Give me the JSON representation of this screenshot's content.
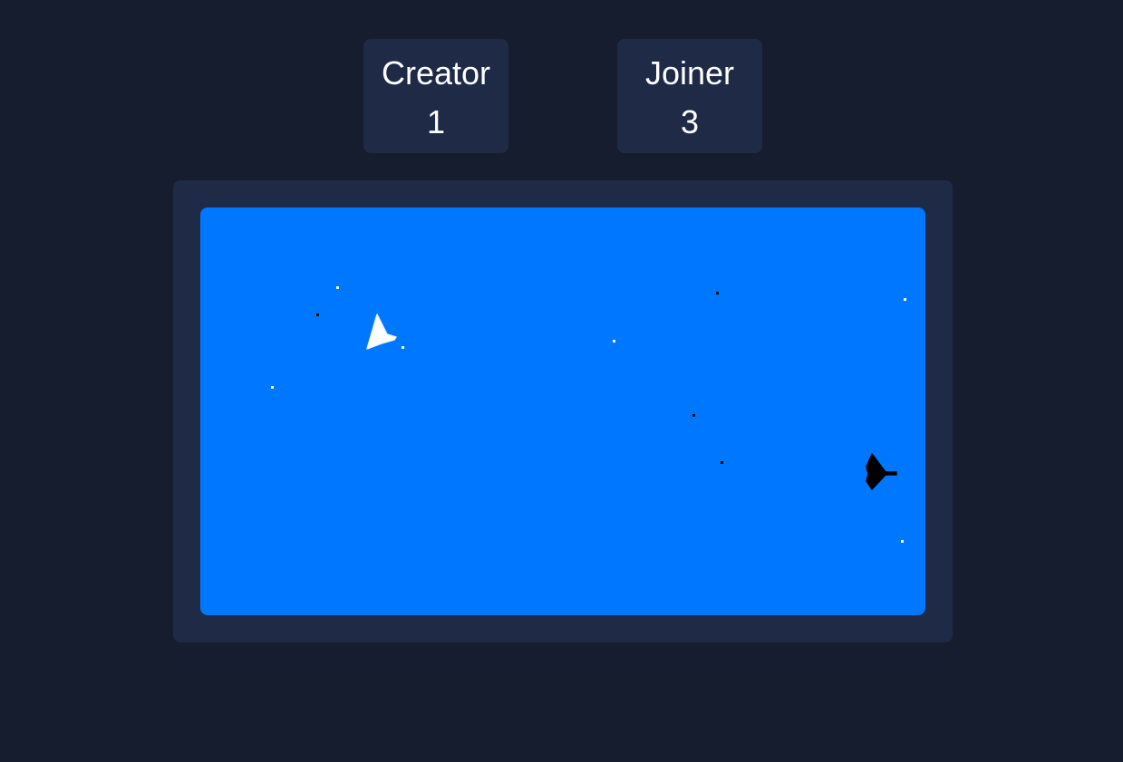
{
  "players": [
    {
      "name": "Creator",
      "score": "1",
      "color": "#ffffff"
    },
    {
      "name": "Joiner",
      "score": "3",
      "color": "#000000"
    }
  ],
  "arena": {
    "background_color": "#0077ff",
    "frame_color": "#1f2a47",
    "ships": [
      {
        "owner": "Creator",
        "color": "#ffffff",
        "heading": "up-right"
      },
      {
        "owner": "Joiner",
        "color": "#000000",
        "heading": "right"
      }
    ],
    "projectile_count": {
      "white": 6,
      "black": 4
    }
  }
}
